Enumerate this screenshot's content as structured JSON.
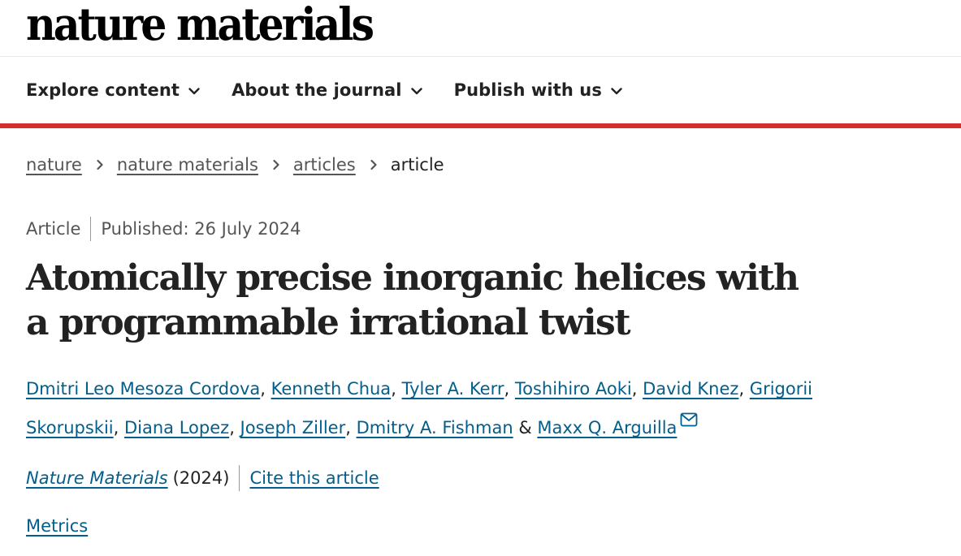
{
  "brand": {
    "logo_text": "nature materials"
  },
  "nav": {
    "items": [
      {
        "label": "Explore content"
      },
      {
        "label": "About the journal"
      },
      {
        "label": "Publish with us"
      }
    ]
  },
  "colors": {
    "accent_rule": "#d32f2f",
    "link": "#025e8d",
    "text": "#222222",
    "muted": "#555555"
  },
  "breadcrumb": {
    "items": [
      {
        "label": "nature"
      },
      {
        "label": "nature materials"
      },
      {
        "label": "articles"
      }
    ],
    "current": "article"
  },
  "article": {
    "type": "Article",
    "published": "Published: 26 July 2024",
    "title": "Atomically precise inorganic helices with a programmable irrational twist",
    "authors": [
      "Dmitri Leo Mesoza Cordova",
      "Kenneth Chua",
      "Tyler A. Kerr",
      "Toshihiro Aoki",
      "David Knez",
      "Grigorii Skorupskii",
      "Diana Lopez",
      "Joseph Ziller",
      "Dmitry A. Fishman",
      "Maxx Q. Arguilla"
    ],
    "author_separator": ", ",
    "author_last_joiner": " & ",
    "corresponding_icon": "envelope-icon",
    "journal": "Nature Materials",
    "year": "(2024)",
    "cite_label": "Cite this article",
    "metrics_label": "Metrics"
  }
}
